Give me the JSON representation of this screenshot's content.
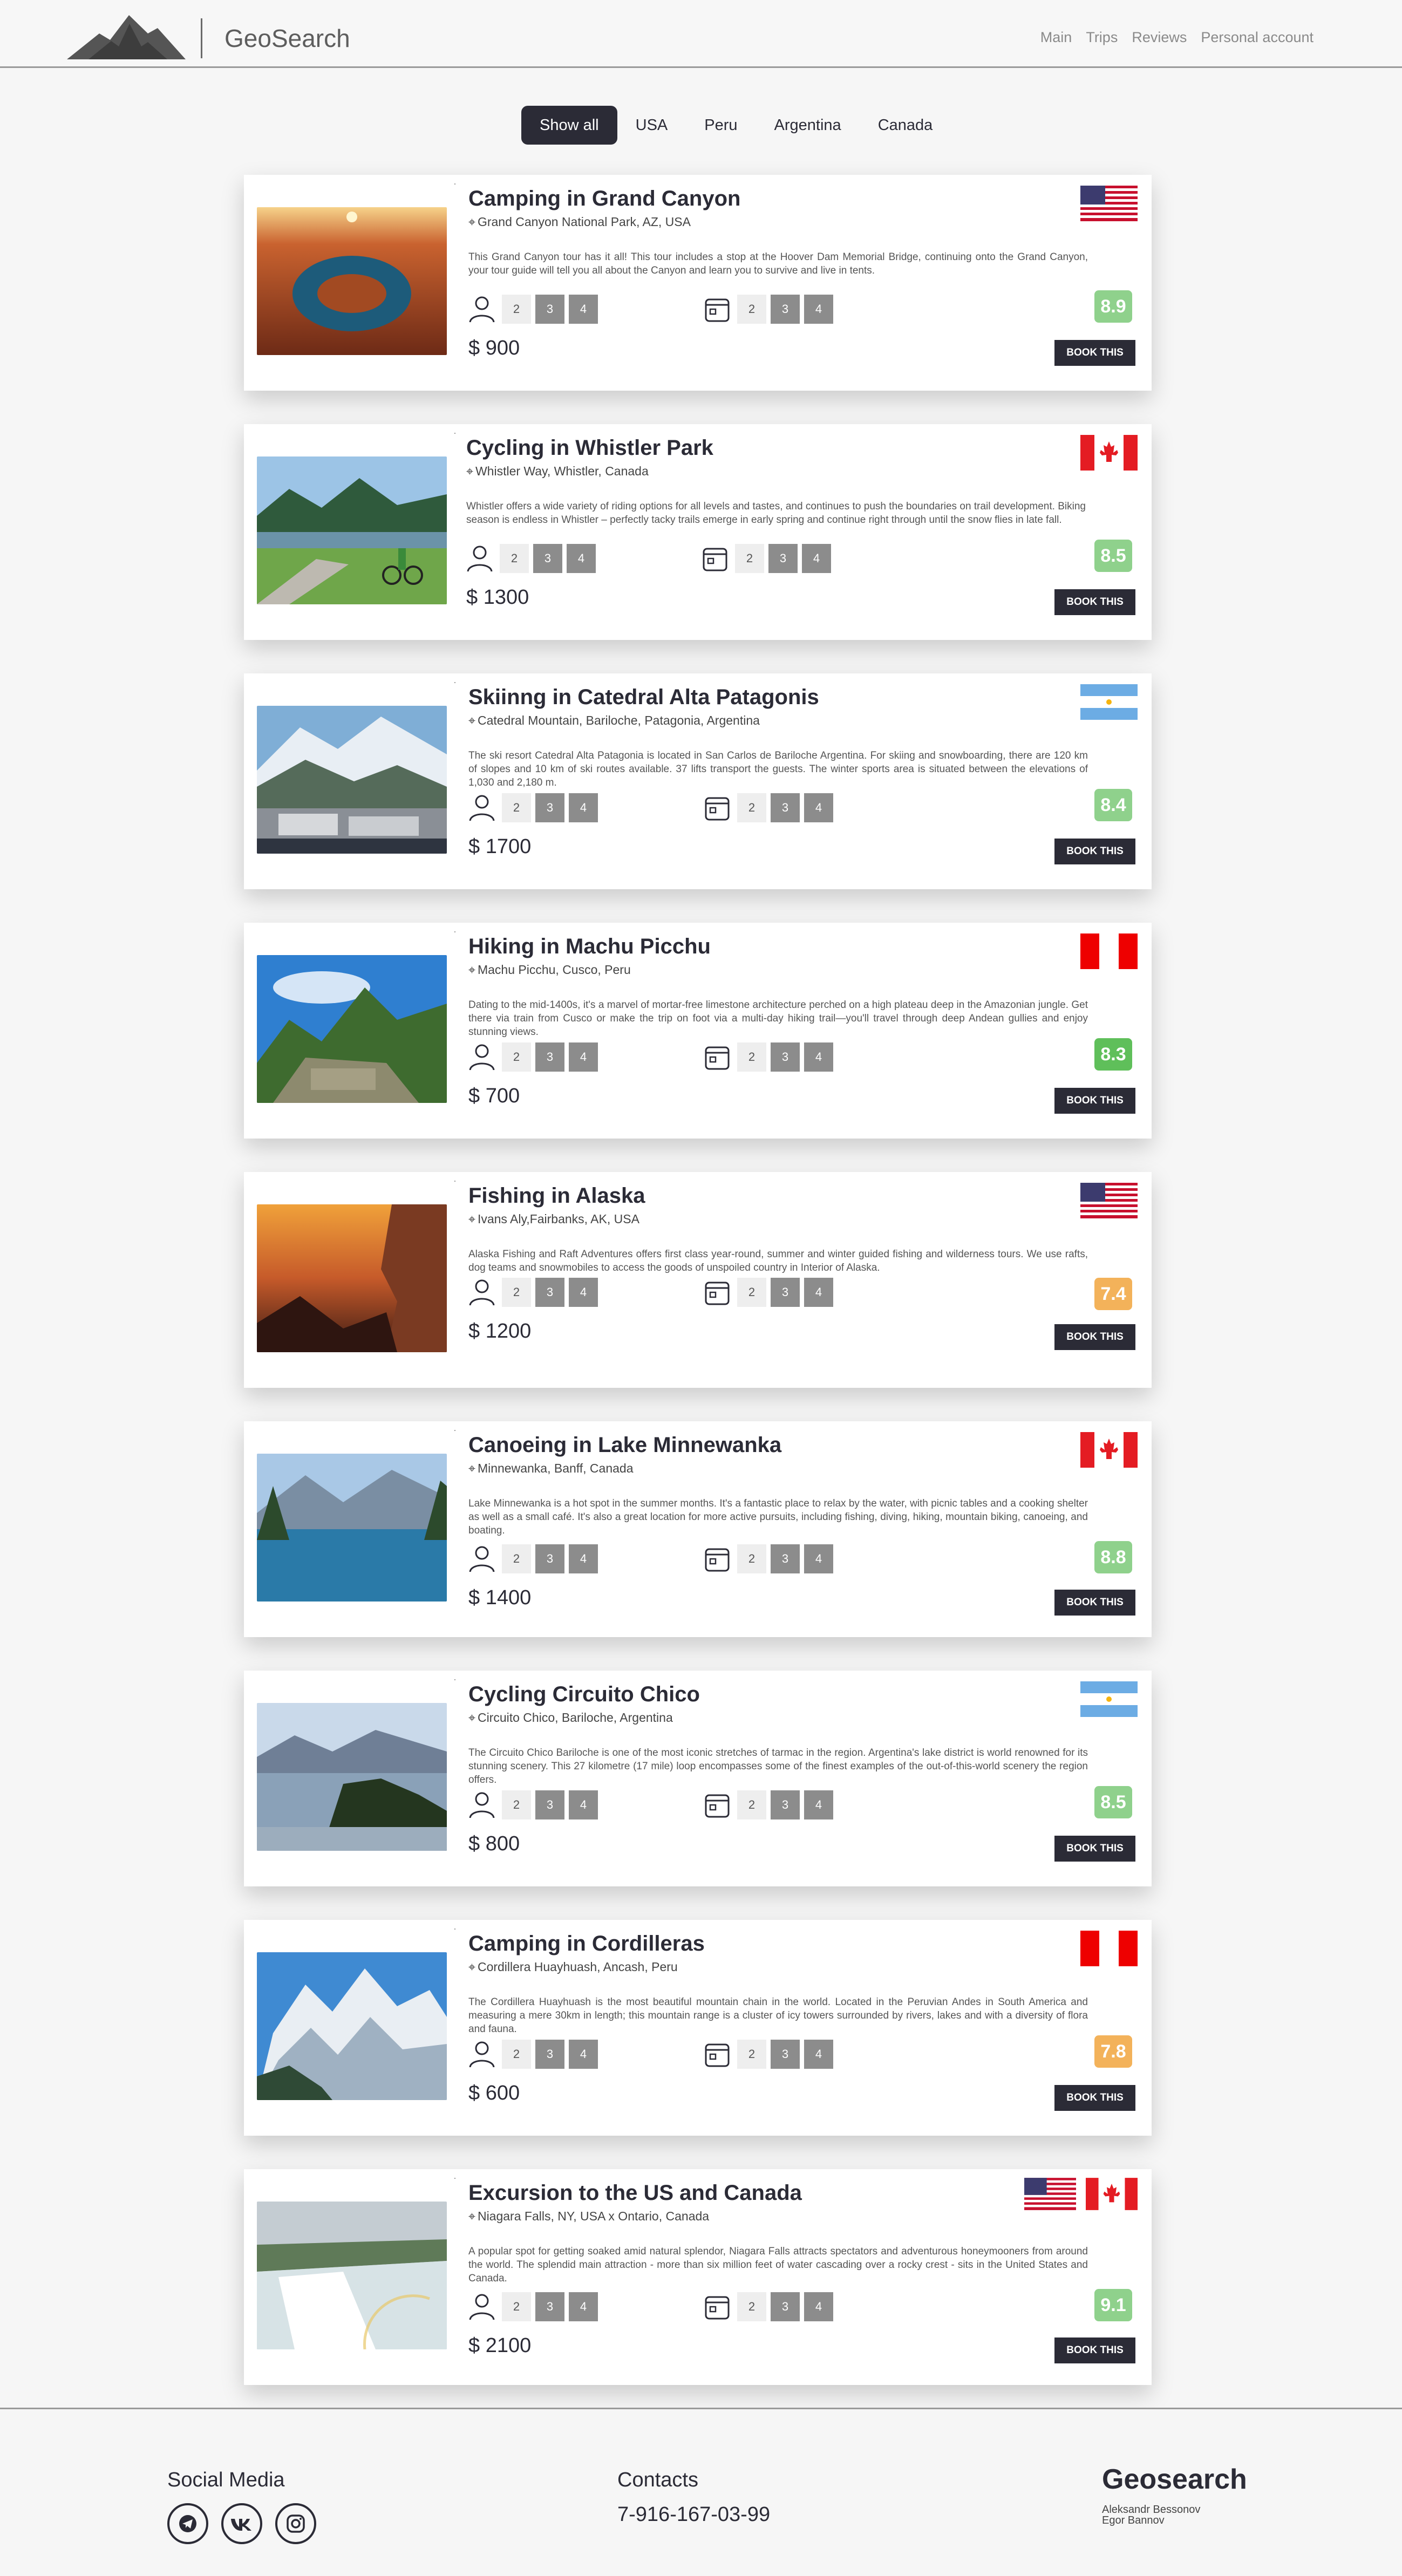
{
  "header": {
    "brand": "GeoSearch",
    "nav": [
      "Main",
      "Trips",
      "Reviews",
      "Personal account"
    ]
  },
  "filters": [
    "Show all",
    "USA",
    "Peru",
    "Argentina",
    "Canada"
  ],
  "active_filter": "Show all",
  "booking_label": "BOOK THIS",
  "option_values": [
    "2",
    "3",
    "4"
  ],
  "colors": {
    "dark": "#2b2b36",
    "rating_green": "#8fd18c",
    "rating_deep_green": "#5fbf5a",
    "rating_orange": "#f3b25a"
  },
  "tours": [
    {
      "title": "Camping in Grand Canyon",
      "location": "Grand Canyon National Park, AZ, USA",
      "description": "This Grand Canyon tour has it all! This tour includes a stop at the Hoover Dam Memorial Bridge, continuing onto the Grand Canyon, your tour guide will tell you all about the Canyon and learn you to survive and live in tents.",
      "price": "$ 900",
      "rating": "8.9",
      "flags": [
        "usa"
      ]
    },
    {
      "title": "Cycling in Whistler Park",
      "location": "Whistler Way, Whistler, Canada",
      "description": "Whistler offers a wide variety of riding options for all levels and tastes, and continues to push the boundaries on trail development. Biking season is endless in Whistler – perfectly tacky trails emerge in early spring and continue right through until the snow flies in late fall.",
      "price": "$ 1300",
      "rating": "8.5",
      "flags": [
        "canada"
      ]
    },
    {
      "title": "Skiinng in Catedral Alta Patagonis",
      "location": "Catedral Mountain, Bariloche, Patagonia, Argentina",
      "description": "The ski resort Catedral Alta Patagonia is located in San Carlos de Bariloche Argentina. For skiing and snowboarding, there are 120 km of slopes and 10 km of ski routes available. 37 lifts transport the guests. The winter sports area is situated between the elevations of 1,030 and 2,180 m.",
      "price": "$ 1700",
      "rating": "8.4",
      "flags": [
        "argentina"
      ]
    },
    {
      "title": "Hiking in Machu Picchu",
      "location": "Machu Picchu, Cusco, Peru",
      "description": "Dating to the mid-1400s, it's a marvel of mortar-free limestone architecture perched on a high plateau deep in the Amazonian jungle. Get there via train from Cusco or make the trip on foot via a multi-day hiking trail—you'll travel through deep Andean gullies and enjoy stunning views.",
      "price": "$ 700",
      "rating": "8.3",
      "flags": [
        "peru"
      ]
    },
    {
      "title": "Fishing in Alaska",
      "location": "Ivans Aly,Fairbanks, AK, USA",
      "description": "Alaska Fishing and Raft Adventures offers first class year-round, summer and winter guided fishing and wilderness tours. We use rafts, dog teams and snowmobiles to access the goods of unspoiled country in Interior of Alaska.",
      "price": "$ 1200",
      "rating": "7.4",
      "flags": [
        "usa"
      ]
    },
    {
      "title": "Canoeing in Lake Minnewanka",
      "location": "Minnewanka, Banff, Canada",
      "description": "Lake Minnewanka is a hot spot in the summer months. It's a fantastic place to relax by the water, with picnic tables and a cooking shelter as well as a small café. It's also a great location for more active pursuits, including fishing, diving, hiking, mountain biking, canoeing, and boating.",
      "price": "$ 1400",
      "rating": "8.8",
      "flags": [
        "canada"
      ]
    },
    {
      "title": "Cycling Circuito Chico",
      "location": "Circuito Chico, Bariloche, Argentina",
      "description": "The Circuito Chico Bariloche is one of the most iconic stretches of tarmac in the region. Argentina's lake district is world renowned for its stunning scenery. This 27 kilometre (17 mile) loop encompasses some of the finest examples of the out-of-this-world scenery the region offers.",
      "price": "$ 800",
      "rating": "8.5",
      "flags": [
        "argentina"
      ]
    },
    {
      "title": "Camping in Cordilleras",
      "location": "Cordillera Huayhuash, Ancash, Peru",
      "description": "The Cordillera Huayhuash is the most beautiful mountain chain in the world. Located in the Peruvian Andes in South America and measuring a mere 30km in length; this mountain range is a cluster of icy towers surrounded by rivers, lakes and with a diversity of flora and fauna.",
      "price": "$ 600",
      "rating": "7.8",
      "flags": [
        "peru"
      ]
    },
    {
      "title": "Excursion to the US and Canada",
      "location": "Niagara Falls, NY, USA x Ontario, Canada",
      "description": "A popular spot for getting soaked amid natural splendor, Niagara Falls attracts spectators and adventurous honeymooners from around the world. The splendid main attraction - more than six million feet of water cascading over a rocky crest - sits in the United States and Canada.",
      "price": "$ 2100",
      "rating": "9.1",
      "flags": [
        "usa",
        "canada"
      ]
    }
  ],
  "footer": {
    "social_title": "Social Media",
    "social_icons": [
      "telegram-icon",
      "vk-icon",
      "instagram-icon"
    ],
    "contacts_title": "Contacts",
    "phone": "7-916-167-03-99",
    "brand": "Geosearch",
    "authors": [
      "Aleksandr Bessonov",
      "Egor Bannov"
    ]
  }
}
